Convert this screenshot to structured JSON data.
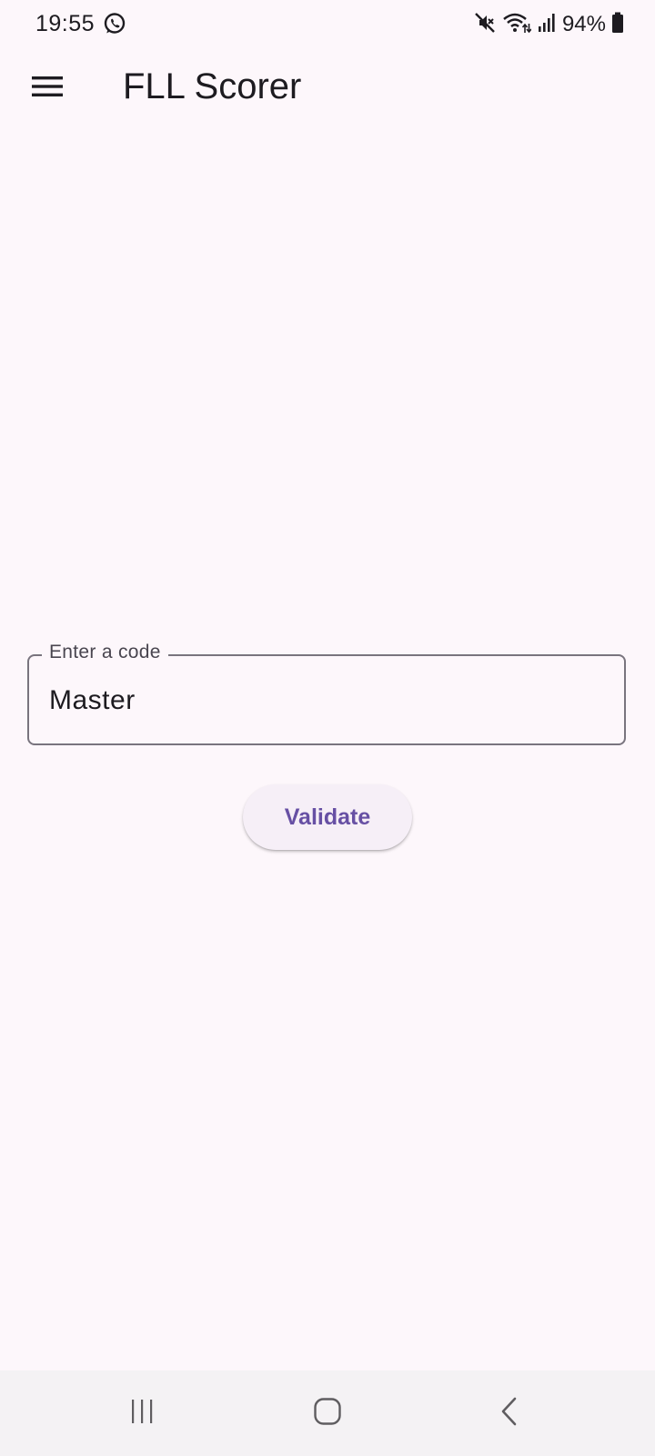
{
  "status_bar": {
    "time": "19:55",
    "battery": "94%",
    "icons": [
      "whatsapp-icon",
      "mute-icon",
      "wifi-icon",
      "signal-icon",
      "battery-icon"
    ]
  },
  "app_bar": {
    "title": "FLL Scorer",
    "menu_icon": "menu-icon"
  },
  "form": {
    "code_field": {
      "label": "Enter a code",
      "value": "Master"
    },
    "validate_label": "Validate"
  },
  "nav_bar": {
    "icons": [
      "recents-icon",
      "home-icon",
      "back-icon"
    ]
  },
  "colors": {
    "background": "#fdf7fb",
    "accent": "#6750a4",
    "outline": "#79747e",
    "button_surface": "#f6eff7",
    "nav_background": "#f4f2f4"
  }
}
